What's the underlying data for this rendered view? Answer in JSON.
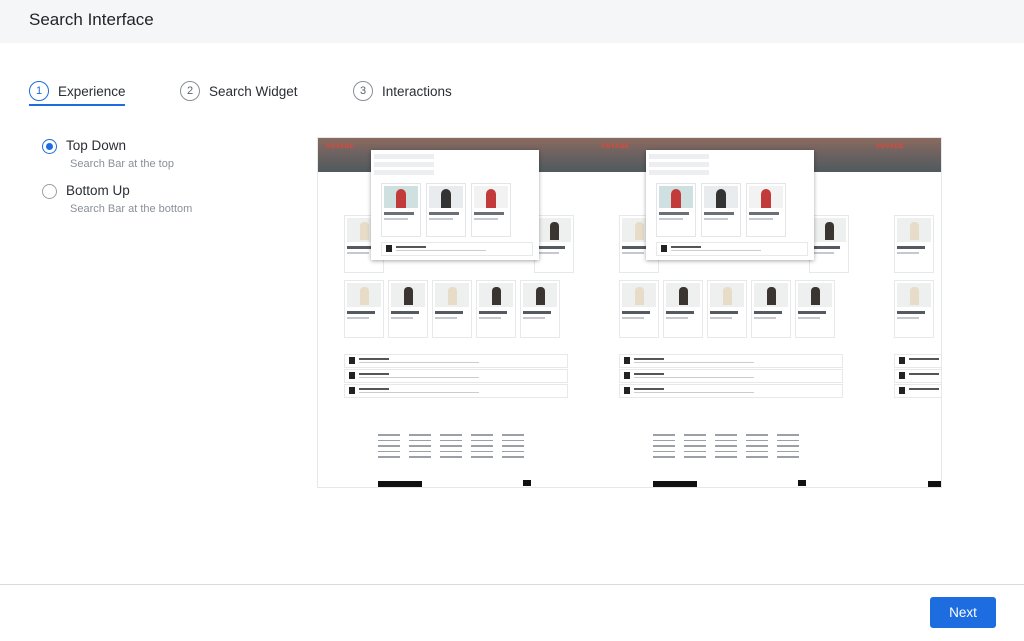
{
  "header": {
    "title": "Search Interface"
  },
  "steps": [
    {
      "number": "1",
      "label": "Experience",
      "active": true
    },
    {
      "number": "2",
      "label": "Search Widget",
      "active": false
    },
    {
      "number": "3",
      "label": "Interactions",
      "active": false
    }
  ],
  "options": [
    {
      "label": "Top Down",
      "description": "Search Bar at the top",
      "selected": true
    },
    {
      "label": "Bottom Up",
      "description": "Search Bar at the bottom",
      "selected": false
    }
  ],
  "preview": {
    "brand": "VOYAGE"
  },
  "footer": {
    "next_label": "Next"
  },
  "colors": {
    "accent": "#1d6ce0",
    "topbar": "#f5f6f8"
  }
}
